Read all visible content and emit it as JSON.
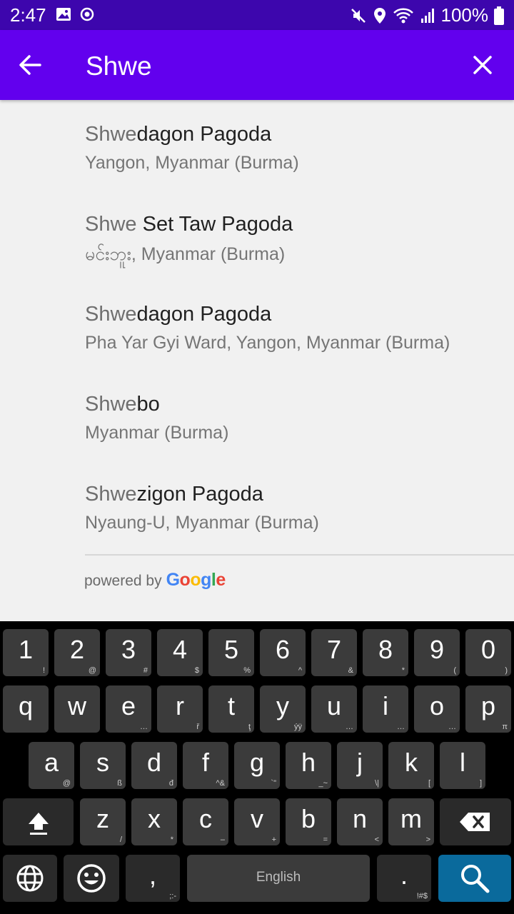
{
  "status_bar": {
    "time": "2:47",
    "battery": "100%"
  },
  "app_bar": {
    "query": "Shwe"
  },
  "results": [
    {
      "match": "Shwe",
      "rest": "dagon Pagoda",
      "subtitle": "Yangon, Myanmar (Burma)"
    },
    {
      "match": "Shwe",
      "rest": " Set Taw Pagoda",
      "subtitle": "မင်းဘူး, Myanmar (Burma)"
    },
    {
      "match": "Shwe",
      "rest": "dagon Pagoda",
      "subtitle": "Pha Yar Gyi Ward, Yangon, Myanmar (Burma)"
    },
    {
      "match": "Shwe",
      "rest": "bo",
      "subtitle": "Myanmar (Burma)"
    },
    {
      "match": "Shwe",
      "rest": "zigon Pagoda",
      "subtitle": "Nyaung-U, Myanmar (Burma)"
    }
  ],
  "attribution": {
    "prefix": "powered by",
    "brand": [
      "G",
      "o",
      "o",
      "g",
      "l",
      "e"
    ]
  },
  "keyboard": {
    "row1": [
      {
        "k": "1",
        "a": "!"
      },
      {
        "k": "2",
        "a": "@"
      },
      {
        "k": "3",
        "a": "#"
      },
      {
        "k": "4",
        "a": "$"
      },
      {
        "k": "5",
        "a": "%"
      },
      {
        "k": "6",
        "a": "^"
      },
      {
        "k": "7",
        "a": "&"
      },
      {
        "k": "8",
        "a": "*"
      },
      {
        "k": "9",
        "a": "("
      },
      {
        "k": "0",
        "a": ")"
      }
    ],
    "row2": [
      {
        "k": "q",
        "a": ""
      },
      {
        "k": "w",
        "a": ""
      },
      {
        "k": "e",
        "a": "…"
      },
      {
        "k": "r",
        "a": "ř"
      },
      {
        "k": "t",
        "a": "ţ"
      },
      {
        "k": "y",
        "a": "ýÿ"
      },
      {
        "k": "u",
        "a": "…"
      },
      {
        "k": "i",
        "a": "…"
      },
      {
        "k": "o",
        "a": "…"
      },
      {
        "k": "p",
        "a": "π"
      }
    ],
    "row3": [
      {
        "k": "a",
        "a": "@"
      },
      {
        "k": "s",
        "a": "ß"
      },
      {
        "k": "d",
        "a": "đ"
      },
      {
        "k": "f",
        "a": "^&"
      },
      {
        "k": "g",
        "a": "`\""
      },
      {
        "k": "h",
        "a": "_~"
      },
      {
        "k": "j",
        "a": "\\|"
      },
      {
        "k": "k",
        "a": "["
      },
      {
        "k": "l",
        "a": "]"
      }
    ],
    "row4": [
      {
        "k": "z",
        "a": "/"
      },
      {
        "k": "x",
        "a": "*"
      },
      {
        "k": "c",
        "a": "–"
      },
      {
        "k": "v",
        "a": "+"
      },
      {
        "k": "b",
        "a": "="
      },
      {
        "k": "n",
        "a": "<"
      },
      {
        "k": "m",
        "a": ">"
      }
    ],
    "comma": {
      "k": ",",
      "a": ";:-"
    },
    "space_label": "English",
    "period": {
      "k": ".",
      "a": "!#$"
    }
  },
  "colors": {
    "status_bar": "#3d06ad",
    "app_bar": "#6200ee",
    "google": [
      "#4285f4",
      "#ea4335",
      "#fbbc05",
      "#4285f4",
      "#34a853",
      "#ea4335"
    ]
  }
}
